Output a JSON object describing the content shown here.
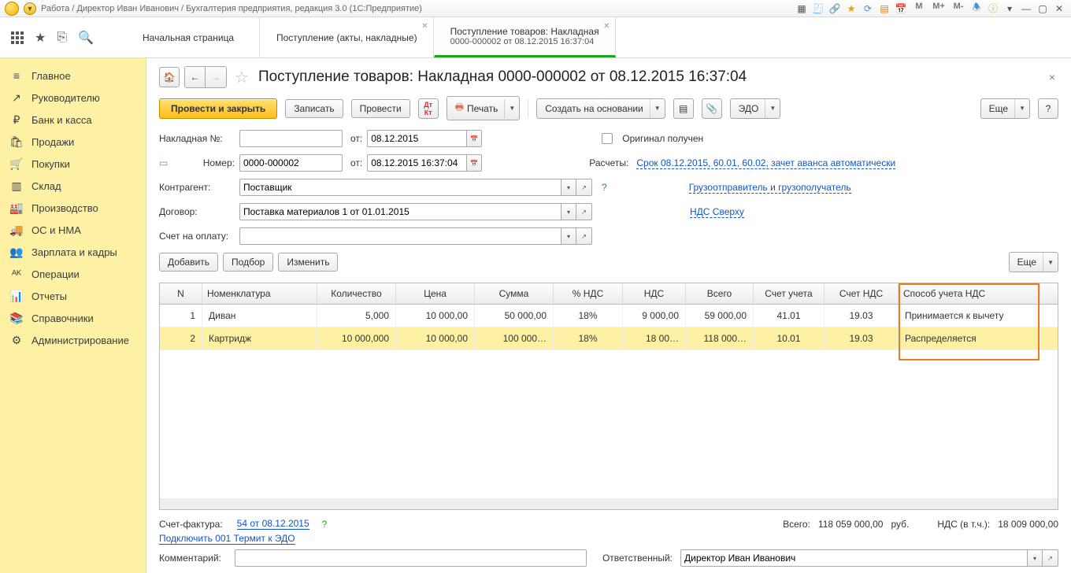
{
  "appbar": {
    "title": "Работа / Директор Иван Иванович / Бухгалтерия предприятия, редакция 3.0  (1С:Предприятие)",
    "m": "M",
    "mp": "M+",
    "mm": "M-"
  },
  "tabs": {
    "t0": "Начальная страница",
    "t1": "Поступление (акты, накладные)",
    "t2_line1": "Поступление товаров: Накладная",
    "t2_line2": "0000-000002 от 08.12.2015 16:37:04"
  },
  "sidebar": {
    "items": [
      {
        "icon": "≡",
        "label": "Главное"
      },
      {
        "icon": "↗",
        "label": "Руководителю"
      },
      {
        "icon": "₽",
        "label": "Банк и касса"
      },
      {
        "icon": "🛍",
        "label": "Продажи"
      },
      {
        "icon": "🛒",
        "label": "Покупки"
      },
      {
        "icon": "▥",
        "label": "Склад"
      },
      {
        "icon": "🏭",
        "label": "Производство"
      },
      {
        "icon": "🚚",
        "label": "ОС и НМА"
      },
      {
        "icon": "👥",
        "label": "Зарплата и кадры"
      },
      {
        "icon": "ᴬᴷ",
        "label": "Операции"
      },
      {
        "icon": "📊",
        "label": "Отчеты"
      },
      {
        "icon": "📚",
        "label": "Справочники"
      },
      {
        "icon": "⚙",
        "label": "Администрирование"
      }
    ]
  },
  "doc": {
    "title": "Поступление товаров: Накладная 0000-000002 от 08.12.2015 16:37:04",
    "post_close": "Провести и закрыть",
    "write": "Записать",
    "post": "Провести",
    "print": "Печать",
    "create_based": "Создать на основании",
    "edo": "ЭДО",
    "more": "Еще",
    "nakladnaya_lbl": "Накладная №:",
    "ot": "от:",
    "date": "08.12.2015",
    "original": "Оригинал получен",
    "number_lbl": "Номер:",
    "number": "0000-000002",
    "datetime": "08.12.2015 16:37:04",
    "calc_lbl": "Расчеты:",
    "calc_link": "Срок 08.12.2015, 60.01, 60.02, зачет аванса автоматически",
    "counterparty_lbl": "Контрагент:",
    "counterparty": "Поставщик",
    "ship_link": "Грузоотправитель и грузополучатель",
    "contract_lbl": "Договор:",
    "contract": "Поставка материалов 1 от 01.01.2015",
    "vat_link": "НДС Сверху",
    "pay_acc_lbl": "Счет на оплату:",
    "add": "Добавить",
    "select": "Подбор",
    "change": "Изменить",
    "more2": "Еще"
  },
  "table": {
    "headers": {
      "n": "N",
      "nom": "Номенклатура",
      "qty": "Количество",
      "price": "Цена",
      "sum": "Сумма",
      "vatp": "% НДС",
      "vat": "НДС",
      "total": "Всего",
      "acc": "Счет учета",
      "vatacc": "Счет НДС",
      "method": "Способ учета НДС"
    },
    "rows": [
      {
        "n": "1",
        "nom": "Диван",
        "qty": "5,000",
        "price": "10 000,00",
        "sum": "50 000,00",
        "vatp": "18%",
        "vat": "9 000,00",
        "total": "59 000,00",
        "acc": "41.01",
        "vatacc": "19.03",
        "method": "Принимается к вычету"
      },
      {
        "n": "2",
        "nom": "Картридж",
        "qty": "10 000,000",
        "price": "10 000,00",
        "sum": "100 000…",
        "vatp": "18%",
        "vat": "18 00…",
        "total": "118 000…",
        "acc": "10.01",
        "vatacc": "19.03",
        "method": "Распределяется"
      }
    ]
  },
  "footer": {
    "sf_lbl": "Счет-фактура:",
    "sf_link": "54 от 08.12.2015",
    "total_lbl": "Всего:",
    "total": "118 059 000,00",
    "cur": "руб.",
    "vat_lbl": "НДС (в т.ч.):",
    "vat": "18 009 000,00",
    "edo_link": "Подключить 001 Термит к ЭДО",
    "comment_lbl": "Комментарий:",
    "resp_lbl": "Ответственный:",
    "resp": "Директор Иван Иванович"
  }
}
